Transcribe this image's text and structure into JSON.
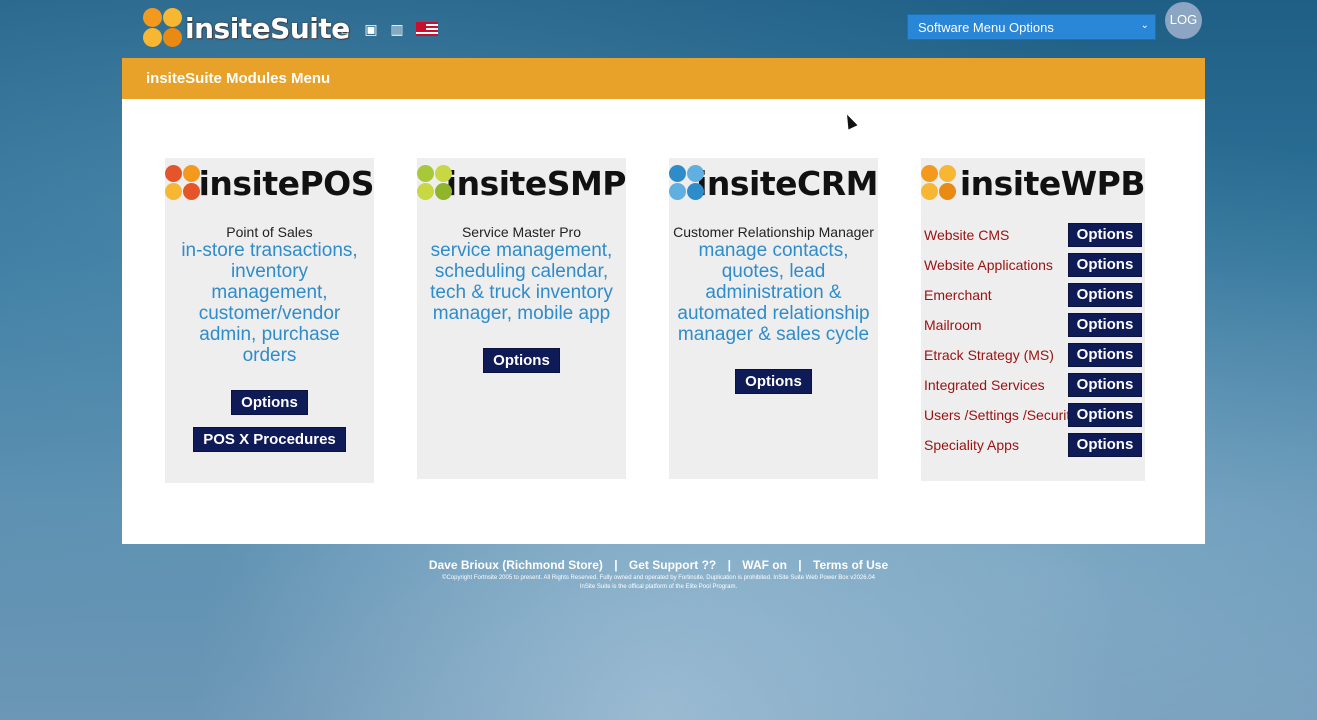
{
  "header": {
    "logo_text": "insiteSuite",
    "menu_select_value": "Software Menu Options",
    "log_label": "LOG",
    "nav_icons": [
      "home-icon",
      "inbox-icon",
      "building-icon",
      "flag-icon"
    ]
  },
  "panel": {
    "title": "insiteSuite Modules Menu"
  },
  "modules": {
    "pos": {
      "title": "insitePOS",
      "subtitle": "Point of Sales",
      "description": "in-store transactions, inventory management, customer/vendor admin, purchase orders",
      "options_label": "Options",
      "procedures_label": "POS X Procedures"
    },
    "smp": {
      "title": "insiteSMP",
      "subtitle": "Service Master Pro",
      "description": "service management, scheduling calendar, tech & truck inventory manager, mobile app",
      "options_label": "Options"
    },
    "crm": {
      "title": "insiteCRM",
      "subtitle": "Customer Relationship Manager",
      "description": "manage contacts, quotes, lead administration & automated relationship manager & sales cycle",
      "options_label": "Options"
    },
    "wpb": {
      "title": "insiteWPB",
      "items": [
        {
          "label": "Website CMS",
          "button": "Options"
        },
        {
          "label": "Website Applications",
          "button": "Options"
        },
        {
          "label": "Emerchant",
          "button": "Options"
        },
        {
          "label": "Mailroom",
          "button": "Options"
        },
        {
          "label": "Etrack Strategy (MS)",
          "button": "Options"
        },
        {
          "label": "Integrated Services",
          "button": "Options"
        },
        {
          "label": "Users /Settings /Security",
          "button": "Options"
        },
        {
          "label": "Speciality Apps",
          "button": "Options"
        }
      ]
    }
  },
  "footer": {
    "user_store": "Dave Brioux (Richmond Store)",
    "sep": "|",
    "support": "Get Support ??",
    "waf": "WAF on",
    "terms": "Terms of Use",
    "copyright": "©Copyright Fortnsite 2005 to present. All Rights Reserved. Fully owned and operated by Fortinsite, Duplication is prohibited. InSite Suite Web Power Box v2026.04",
    "platform": "InSite Suite is the offical platform of the Elite Pool Program."
  },
  "colors": {
    "header_bar": "#e9a229",
    "button_navy": "#0f1b56",
    "description_blue": "#2f8ccb",
    "wpb_label_red": "#9a1111",
    "select_blue": "#2a86d6"
  }
}
